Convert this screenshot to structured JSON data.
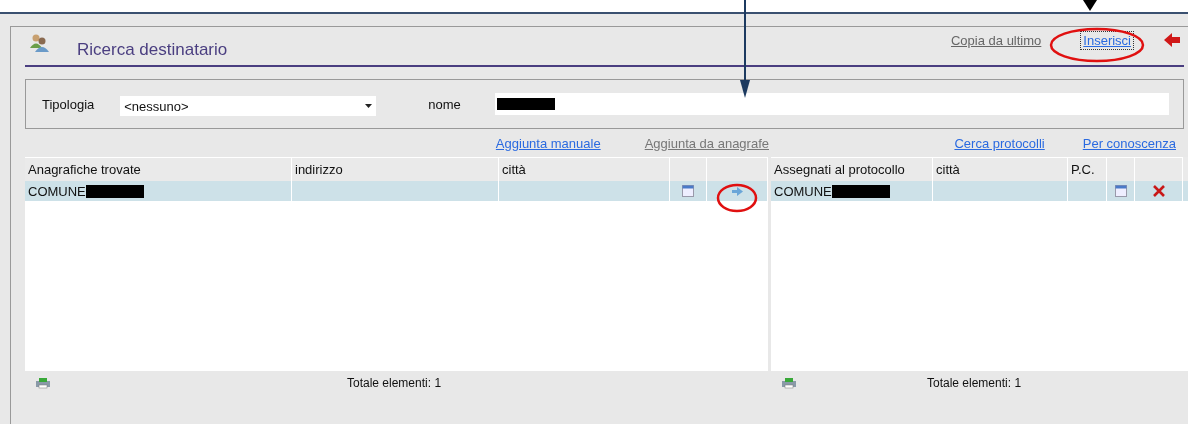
{
  "dialog": {
    "title": "Ricerca destinatario",
    "actions": [
      {
        "label": "Copia da ultimo",
        "focused": false
      },
      {
        "label": "Inserisci",
        "focused": true
      }
    ]
  },
  "filter": {
    "type_label": "Tipologia",
    "type_value": "<nessuno>",
    "name_label": "nome",
    "name_redacted": true
  },
  "links": [
    {
      "label": "Aggiunta manuale",
      "disabled": false
    },
    {
      "label": "Aggiunta da anagrafe",
      "disabled": true
    },
    {
      "label": "Cerca protocolli",
      "disabled": false
    },
    {
      "label": "Per conoscenza",
      "disabled": false
    }
  ],
  "found_table": {
    "columns": [
      "Anagrafiche trovate",
      "indirizzo",
      "città"
    ],
    "rows": [
      {
        "name": "COMUNE",
        "redacted": true,
        "selected": true
      }
    ],
    "total": "Totale elementi: 1"
  },
  "assigned_table": {
    "columns": [
      "Assegnati al protocollo",
      "città",
      "P.C."
    ],
    "rows": [
      {
        "name": "COMUNE",
        "redacted": true,
        "selected": true
      }
    ],
    "total": "Totale elementi: 1"
  }
}
